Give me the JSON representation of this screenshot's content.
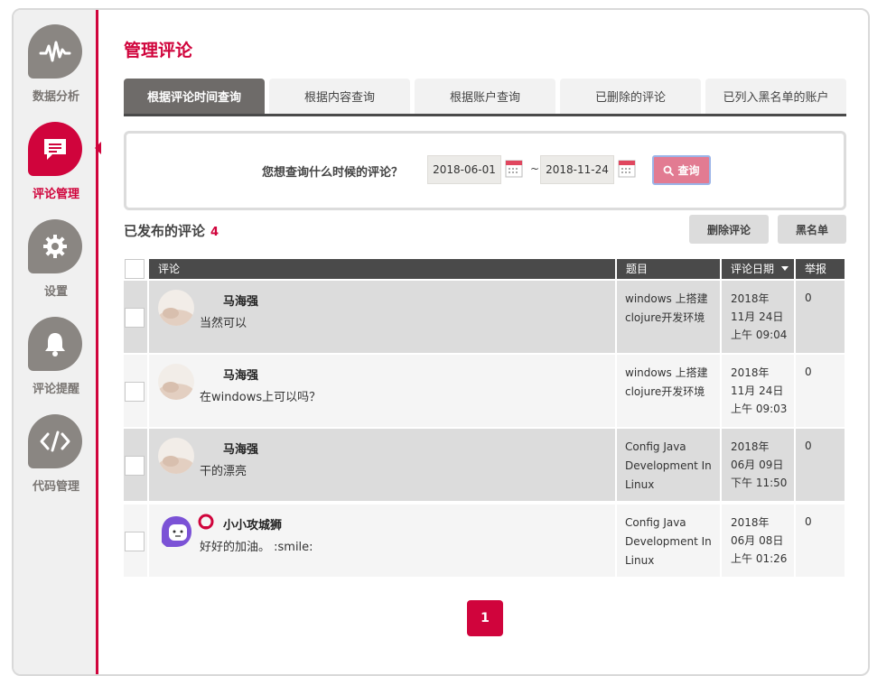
{
  "sidebar": {
    "items": [
      {
        "label": "数据分析",
        "icon": "pulse-icon"
      },
      {
        "label": "评论管理",
        "icon": "comment-icon",
        "active": true
      },
      {
        "label": "设置",
        "icon": "gear-icon"
      },
      {
        "label": "评论提醒",
        "icon": "bell-icon"
      },
      {
        "label": "代码管理",
        "icon": "code-icon"
      }
    ]
  },
  "page": {
    "title": "管理评论"
  },
  "tabs": [
    {
      "label": "根据评论时间查询",
      "active": true
    },
    {
      "label": "根据内容查询"
    },
    {
      "label": "根据账户查询"
    },
    {
      "label": "已删除的评论"
    },
    {
      "label": "已列入黑名单的账户"
    }
  ],
  "query": {
    "label": "您想查询什么时候的评论？",
    "start_date": "2018-06-01",
    "end_date": "2018-11-24",
    "separator": "~",
    "button": "查询"
  },
  "list": {
    "title": "已发布的评论",
    "count": "4",
    "delete_button": "删除评论",
    "blacklist_button": "黑名单"
  },
  "table": {
    "headers": {
      "comment": "评论",
      "topic": "题目",
      "date": "评论日期",
      "report": "举报"
    },
    "rows": [
      {
        "author": "马海强",
        "content": "当然可以",
        "topic": "windows 上搭建clojure开发环境",
        "date_year": "2018年",
        "date_day": "11月 24日",
        "date_time": "上午 09:04",
        "report": "0"
      },
      {
        "author": "马海强",
        "content": "在windows上可以吗？",
        "topic": "windows 上搭建clojure开发环境",
        "date_year": "2018年",
        "date_day": "11月 24日",
        "date_time": "上午 09:03",
        "report": "0"
      },
      {
        "author": "马海强",
        "content": "干的漂亮",
        "topic": "Config Java Development In Linux",
        "date_year": "2018年",
        "date_day": "06月 09日",
        "date_time": "下午 11:50",
        "report": "0"
      },
      {
        "author": "小小攻城狮",
        "content": "好好的加油。 :smile:",
        "topic": "Config Java Development In Linux",
        "date_year": "2018年",
        "date_day": "06月 08日",
        "date_time": "上午 01:26",
        "report": "0"
      }
    ]
  },
  "pagination": {
    "current": "1"
  },
  "colors": {
    "accent": "#d0043c",
    "nav_gray": "#8a8682",
    "header_dark": "#4a4a4a"
  }
}
